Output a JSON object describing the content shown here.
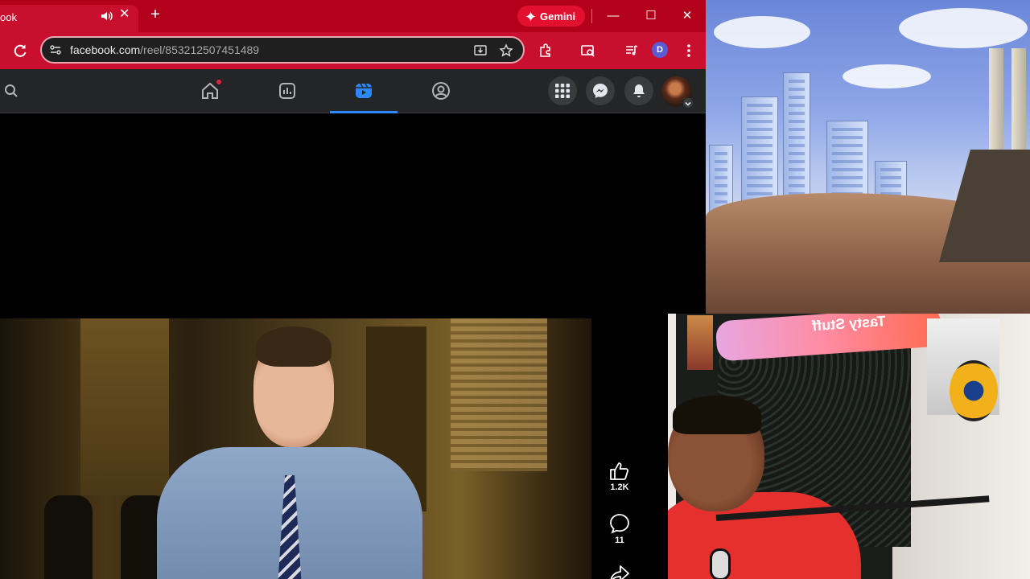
{
  "browser": {
    "tab_title": "ook",
    "gemini_label": "Gemini",
    "url_host": "facebook.com",
    "url_path": "/reel/853212507451489",
    "profile_initial": "D"
  },
  "reel": {
    "likes": "1.2K",
    "comments": "11"
  },
  "overlay": {
    "light_text": "Tasty Stuff"
  }
}
